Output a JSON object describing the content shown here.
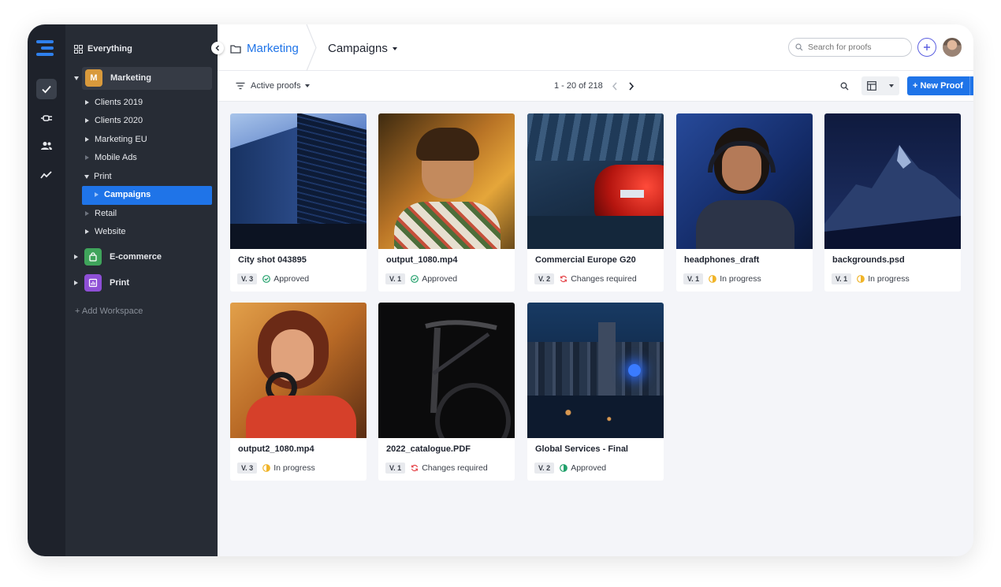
{
  "sidebar": {
    "everything_label": "Everything",
    "workspaces": [
      {
        "letter": "M",
        "label": "Marketing",
        "color": "#d99a3c"
      },
      {
        "label": "E-commerce",
        "color": "#3fa45b"
      },
      {
        "label": "Print",
        "color": "#8e4fd6"
      }
    ],
    "folders": [
      {
        "label": "Clients 2019"
      },
      {
        "label": "Clients 2020"
      },
      {
        "label": "Marketing EU"
      },
      {
        "label": "Mobile Ads"
      },
      {
        "label": "Print"
      },
      {
        "label": "Campaigns"
      },
      {
        "label": "Retail"
      },
      {
        "label": "Website"
      }
    ],
    "add_workspace": "+ Add Workspace"
  },
  "breadcrumb": {
    "folder": "Marketing",
    "current": "Campaigns"
  },
  "search": {
    "placeholder": "Search for proofs"
  },
  "toolbar": {
    "filter_label": "Active proofs",
    "pagination": "1 - 20 of 218",
    "new_proof_label": "+ New Proof"
  },
  "colors": {
    "accent": "#1f74e8",
    "approved": "#22a06b",
    "changes_required": "#e5484d",
    "in_progress": "#f0b429"
  },
  "proofs": [
    {
      "title": "City shot 043895",
      "version": "V. 3",
      "status": "Approved",
      "status_type": "approved"
    },
    {
      "title": "output_1080.mp4",
      "version": "V. 1",
      "status": "Approved",
      "status_type": "approved"
    },
    {
      "title": "Commercial Europe G20",
      "version": "V. 2",
      "status": "Changes required",
      "status_type": "changes"
    },
    {
      "title": "headphones_draft",
      "version": "V. 1",
      "status": "In progress",
      "status_type": "progress"
    },
    {
      "title": "backgrounds.psd",
      "version": "V. 1",
      "status": "In progress",
      "status_type": "progress"
    },
    {
      "title": "output2_1080.mp4",
      "version": "V. 3",
      "status": "In progress",
      "status_type": "progress"
    },
    {
      "title": "2022_catalogue.PDF",
      "version": "V. 1",
      "status": "Changes required",
      "status_type": "changes"
    },
    {
      "title": "Global Services - Final",
      "version": "V. 2",
      "status": "Approved",
      "status_type": "approved"
    }
  ]
}
